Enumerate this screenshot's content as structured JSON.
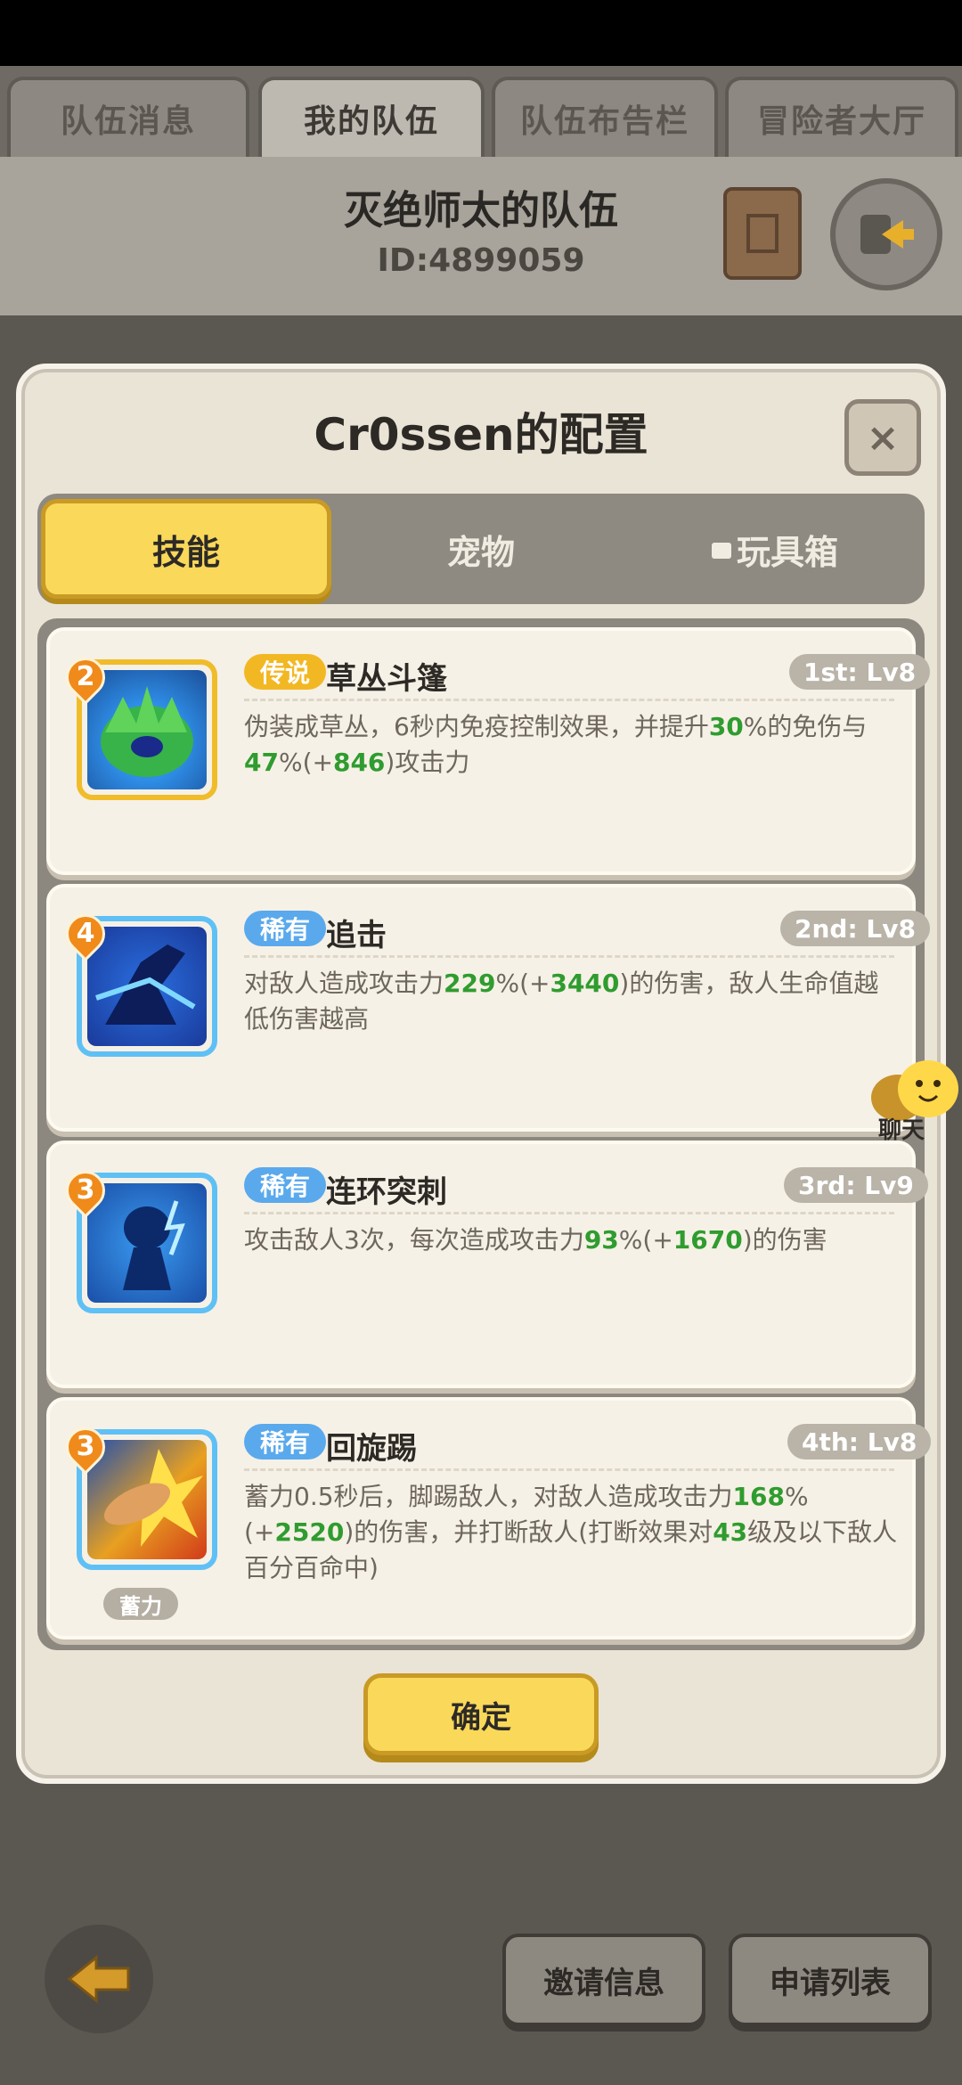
{
  "top_tabs": [
    {
      "label": "队伍消息",
      "active": false
    },
    {
      "label": "我的队伍",
      "active": true
    },
    {
      "label": "队伍布告栏",
      "active": false
    },
    {
      "label": "冒险者大厅",
      "active": false
    }
  ],
  "team": {
    "name": "灭绝师太的队伍",
    "id": "ID:4899059"
  },
  "modal": {
    "title": "Cr0ssen的配置",
    "close_label": "×",
    "tabs": [
      {
        "label": "技能",
        "active": true,
        "locked": false
      },
      {
        "label": "宠物",
        "active": false,
        "locked": false
      },
      {
        "label": "玩具箱",
        "active": false,
        "locked": true
      }
    ],
    "skills": [
      {
        "level": "2",
        "rarity": "传说",
        "name": "草丛斗篷",
        "slot": "1st: Lv8",
        "desc": [
          "伪装成草丛，6秒内免疫控制效果，并提升",
          "30",
          "%的免伤与",
          "47",
          "%(+",
          "846",
          ")攻击力"
        ]
      },
      {
        "level": "4",
        "rarity": "稀有",
        "name": "追击",
        "slot": "2nd: Lv8",
        "desc": [
          "对敌人造成攻击力",
          "229",
          "%(+",
          "3440",
          ")的伤害，敌人生命值越低伤害越高"
        ]
      },
      {
        "level": "3",
        "rarity": "稀有",
        "name": "连环突刺",
        "slot": "3rd: Lv9",
        "desc": [
          "攻击敌人3次，每次造成攻击力",
          "93",
          "%(+",
          "1670",
          ")的伤害"
        ]
      },
      {
        "level": "3",
        "rarity": "稀有",
        "name": "回旋踢",
        "slot": "4th: Lv8",
        "tag": "蓄力",
        "desc": [
          "蓄力0.5秒后，脚踢敌人，对敌人造成攻击力",
          "168",
          "%(+",
          "2520",
          ")的伤害，并打断敌人(打断效果对",
          "43",
          "级及以下敌人百分百命中)"
        ]
      }
    ],
    "confirm_label": "确定"
  },
  "chat_label": "聊天",
  "bottom": {
    "invite_label": "邀请信息",
    "apply_label": "申请列表"
  }
}
